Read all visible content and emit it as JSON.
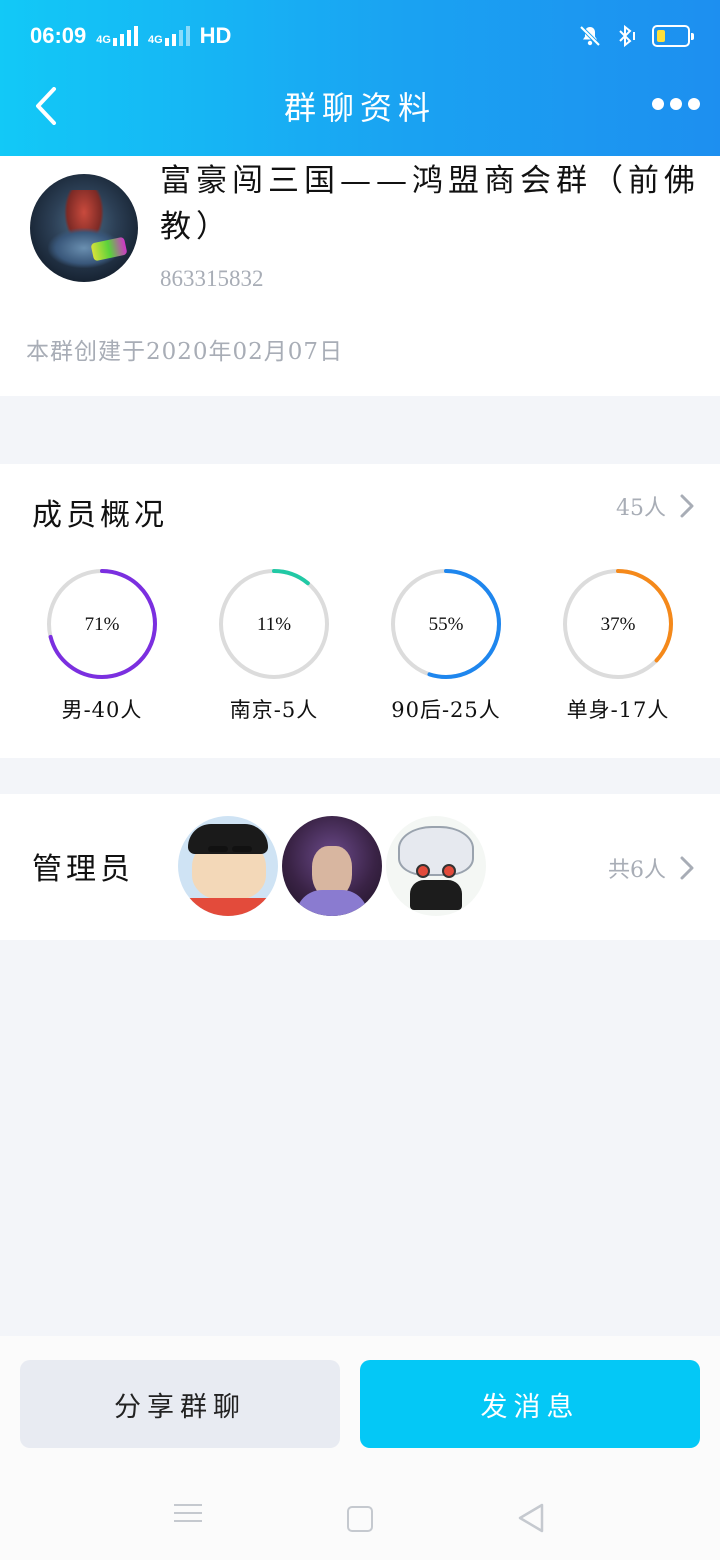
{
  "status_bar": {
    "time": "06:09",
    "network1": "4G",
    "network2": "4G",
    "hd": "HD",
    "icons": [
      "mute-icon",
      "bluetooth-icon",
      "battery-icon"
    ]
  },
  "nav": {
    "title": "群聊资料",
    "back_icon": "chevron-left-icon",
    "more_icon": "more-dots-icon"
  },
  "group": {
    "name": "富豪闯三国——鸿盟商会群（前佛教）",
    "id": "863315832",
    "created": "本群创建于2020年02月07日"
  },
  "members": {
    "title": "成员概况",
    "count": "45人",
    "stats": [
      {
        "percent": 71,
        "percent_label": "71%",
        "label": "男-40人",
        "color": "#7b2fe0"
      },
      {
        "percent": 11,
        "percent_label": "11%",
        "label": "南京-5人",
        "color": "#21c9a5"
      },
      {
        "percent": 55,
        "percent_label": "55%",
        "label": "90后-25人",
        "color": "#1e86ee"
      },
      {
        "percent": 37,
        "percent_label": "37%",
        "label": "单身-17人",
        "color": "#f5891a"
      }
    ]
  },
  "admins": {
    "title": "管理员",
    "count": "共6人"
  },
  "actions": {
    "share": "分享群聊",
    "send": "发消息"
  },
  "colors": {
    "header_start": "#12c9f7",
    "header_end": "#1d8ff0",
    "primary_button": "#04c8f6",
    "secondary_button": "#e8ebf2",
    "muted_text": "#a8adb6"
  }
}
